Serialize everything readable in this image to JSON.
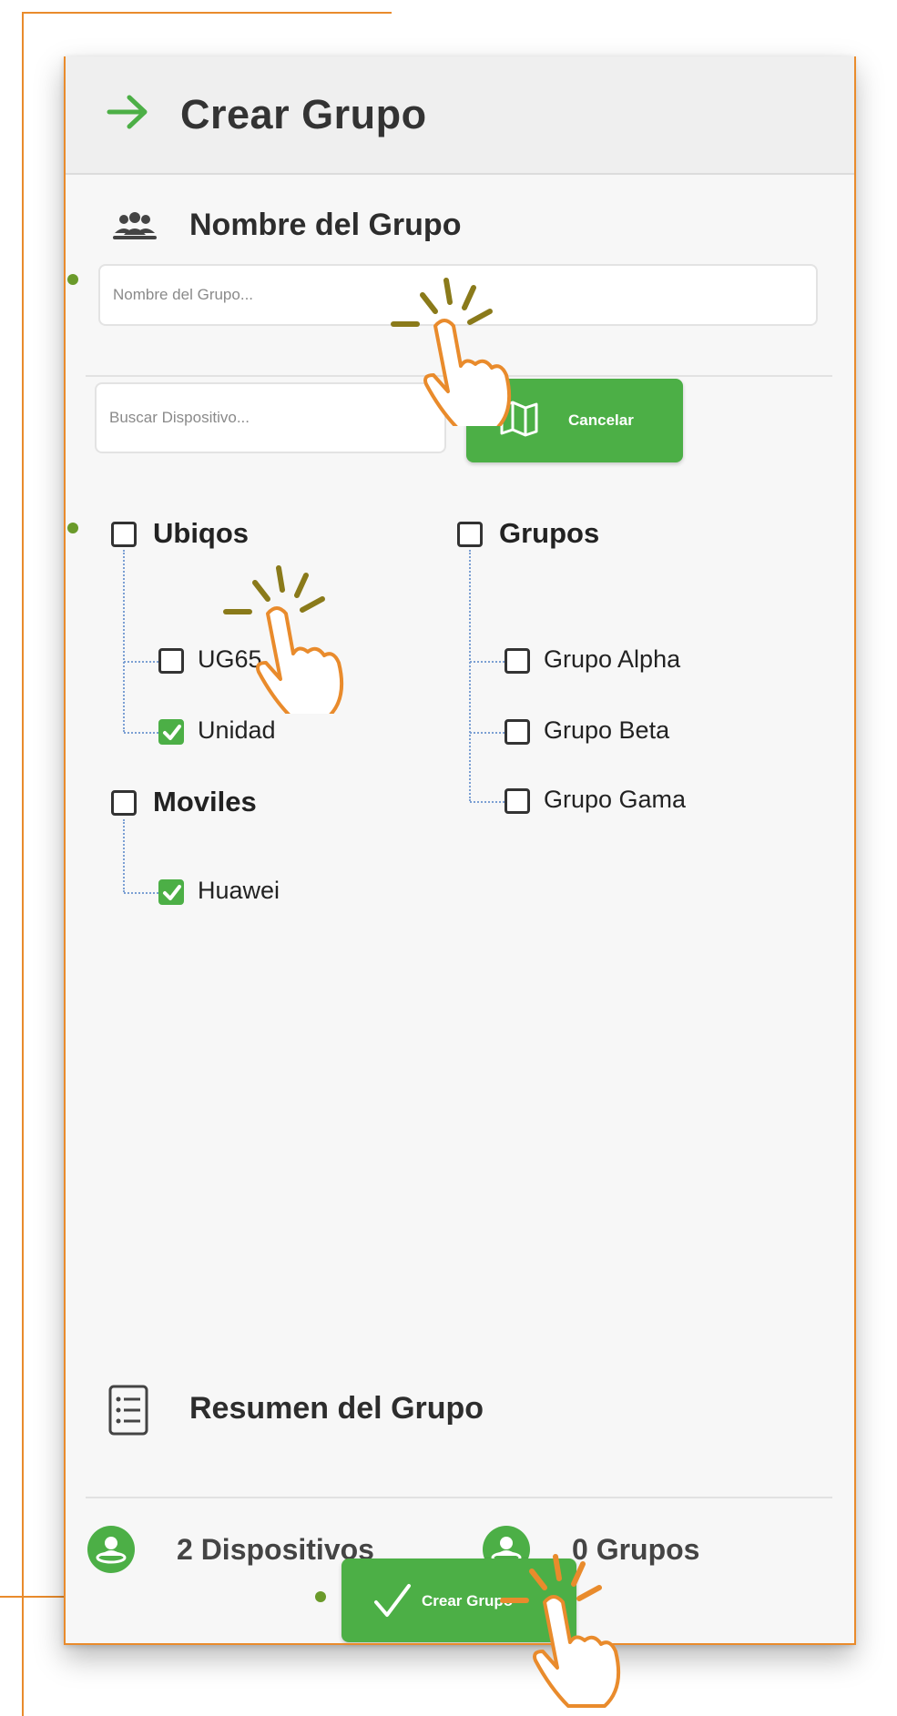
{
  "header": {
    "title": "Crear Grupo",
    "icon": "arrow-right-icon"
  },
  "group_name": {
    "section_title": "Nombre del Grupo",
    "icon": "users-icon",
    "placeholder": "Nombre del Grupo..."
  },
  "search": {
    "placeholder": "Buscar Dispositivo...",
    "cancel_label": "Cancelar",
    "cancel_icon": "map-icon"
  },
  "tree": {
    "ubiqos": {
      "label": "Ubiqos",
      "checked": false,
      "items": [
        {
          "label": "UG65",
          "checked": false
        },
        {
          "label": "Unidad",
          "checked": true
        }
      ]
    },
    "moviles": {
      "label": "Moviles",
      "checked": false,
      "items": [
        {
          "label": "Huawei",
          "checked": true
        }
      ]
    },
    "grupos": {
      "label": "Grupos",
      "checked": false,
      "items": [
        {
          "label": "Grupo Alpha",
          "checked": false
        },
        {
          "label": "Grupo Beta",
          "checked": false
        },
        {
          "label": "Grupo Gama",
          "checked": false
        }
      ]
    }
  },
  "summary": {
    "section_title": "Resumen del Grupo",
    "icon": "list-icon",
    "devices": "2 Dispositivos",
    "groups": "0 Grupos"
  },
  "create_button": {
    "label": "Crear Grupo",
    "icon": "check-icon"
  },
  "colors": {
    "accent": "#4caf46",
    "annotation": "#e98b2c",
    "dot": "#6a9a2a"
  }
}
